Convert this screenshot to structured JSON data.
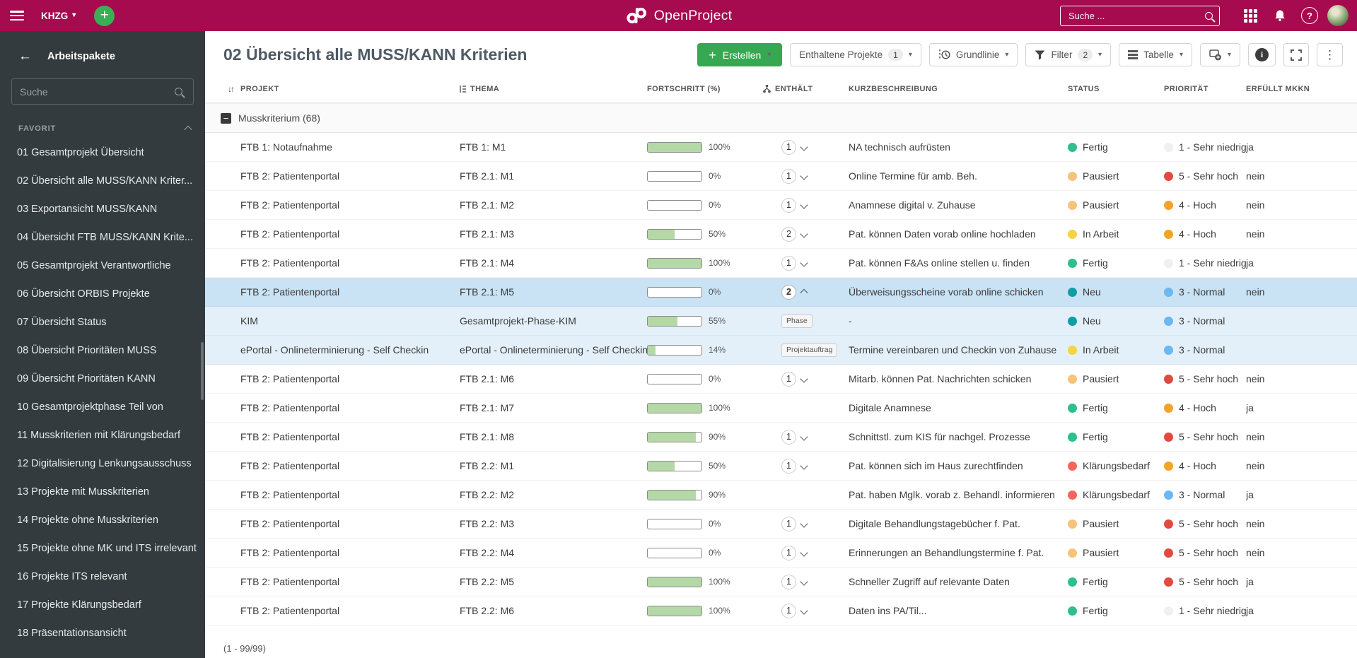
{
  "icons": {
    "caret": "▾",
    "kebab": "⋮",
    "back": "←",
    "plus": "+",
    "question": "?",
    "sort": "↓↑",
    "collapse": "−",
    "info": "i"
  },
  "header": {
    "project_selector": "KHZG",
    "logo_text": "OpenProject",
    "search_placeholder": "Suche ..."
  },
  "sidebar": {
    "title": "Arbeitspakete",
    "search_placeholder": "Suche",
    "section": "FAVORIT",
    "items": [
      "01 Gesamtprojekt Übersicht",
      "02 Übersicht alle MUSS/KANN Kriter...",
      "03 Exportansicht MUSS/KANN",
      "04 Übersicht FTB MUSS/KANN Krite...",
      "05 Gesamtprojekt Verantwortliche",
      "06 Übersicht ORBIS Projekte",
      "07 Übersicht Status",
      "08 Übersicht Prioritäten MUSS",
      "09 Übersicht Prioritäten KANN",
      "10 Gesamtprojektphase Teil von",
      "11 Musskriterien mit Klärungsbedarf",
      "12 Digitalisierung Lenkungsausschuss",
      "13 Projekte mit Musskriterien",
      "14 Projekte ohne Musskriterien",
      "15 Projekte ohne MK und ITS irrelevant",
      "16 Projekte ITS relevant",
      "17 Projekte Klärungsbedarf",
      "18 Präsentationsansicht"
    ]
  },
  "toolbar": {
    "title": "02 Übersicht alle MUSS/KANN Kriterien",
    "create_label": "Erstellen",
    "included_projects_label": "Enthaltene Projekte",
    "included_projects_count": "1",
    "baseline_label": "Grundlinie",
    "filter_label": "Filter",
    "filter_count": "2",
    "table_label": "Tabelle"
  },
  "table": {
    "columns": [
      "PROJEKT",
      "THEMA",
      "FORTSCHRITT (%)",
      "ENTHÄLT",
      "KURZBESCHREIBUNG",
      "STATUS",
      "PRIORITÄT",
      "ERFÜLLT MKKN"
    ],
    "group_label": "Musskriterium",
    "group_count": "(68)",
    "status_colors": {
      "Fertig": "#2fbe8f",
      "Pausiert": "#f6c37a",
      "In Arbeit": "#f5d342",
      "Neu": "#0f9ea6",
      "Klärungsbedarf": "#f2665e"
    },
    "priority_colors": {
      "1 - Sehr niedrig": "#f0f0f0",
      "3 - Normal": "#6cb8f0",
      "4 - Hoch": "#f5a22d",
      "5 - Sehr hoch": "#e04a41"
    },
    "rows": [
      {
        "project": "FTB 1: Notaufnahme",
        "thema": "FTB 1: M1",
        "progress": 100,
        "progress_label": "100%",
        "contains": "1",
        "expanded": false,
        "badge": "",
        "desc": "NA technisch aufrüsten",
        "status": "Fertig",
        "priority": "1 - Sehr niedrig",
        "erfuellt": "ja",
        "highlight": ""
      },
      {
        "project": "FTB 2: Patientenportal",
        "thema": "FTB 2.1: M1",
        "progress": 0,
        "progress_label": "0%",
        "contains": "1",
        "expanded": false,
        "badge": "",
        "desc": "Online Termine für amb. Beh.",
        "status": "Pausiert",
        "priority": "5 - Sehr hoch",
        "erfuellt": "nein",
        "highlight": ""
      },
      {
        "project": "FTB 2: Patientenportal",
        "thema": "FTB 2.1: M2",
        "progress": 0,
        "progress_label": "0%",
        "contains": "1",
        "expanded": false,
        "badge": "",
        "desc": "Anamnese digital v. Zuhause",
        "status": "Pausiert",
        "priority": "4 - Hoch",
        "erfuellt": "nein",
        "highlight": ""
      },
      {
        "project": "FTB 2: Patientenportal",
        "thema": "FTB 2.1: M3",
        "progress": 50,
        "progress_label": "50%",
        "contains": "2",
        "expanded": false,
        "badge": "",
        "desc": "Pat. können Daten vorab online hochladen",
        "status": "In Arbeit",
        "priority": "4 - Hoch",
        "erfuellt": "nein",
        "highlight": ""
      },
      {
        "project": "FTB 2: Patientenportal",
        "thema": "FTB 2.1: M4",
        "progress": 100,
        "progress_label": "100%",
        "contains": "1",
        "expanded": false,
        "badge": "",
        "desc": "Pat. können F&As online stellen u. finden",
        "status": "Fertig",
        "priority": "1 - Sehr niedrig",
        "erfuellt": "ja",
        "highlight": ""
      },
      {
        "project": "FTB 2: Patientenportal",
        "thema": "FTB 2.1: M5",
        "progress": 0,
        "progress_label": "0%",
        "contains": "2",
        "expanded": true,
        "badge": "",
        "desc": "Überweisungsscheine vorab online schicken",
        "status": "Neu",
        "priority": "3 - Normal",
        "erfuellt": "nein",
        "highlight": "selected"
      },
      {
        "project": "KIM",
        "thema": "Gesamtprojekt-Phase-KIM",
        "progress": 55,
        "progress_label": "55%",
        "contains": "",
        "expanded": false,
        "badge": "Phase",
        "desc": "-",
        "status": "Neu",
        "priority": "3 - Normal",
        "erfuellt": "",
        "highlight": "child"
      },
      {
        "project": "ePortal - Onlineterminierung - Self Checkin",
        "thema": "ePortal - Onlineterminierung - Self Checkin",
        "progress": 14,
        "progress_label": "14%",
        "contains": "",
        "expanded": false,
        "badge": "Projektauftrag",
        "desc": "Termine vereinbaren und Checkin von Zuhause",
        "status": "In Arbeit",
        "priority": "3 - Normal",
        "erfuellt": "",
        "highlight": "child"
      },
      {
        "project": "FTB 2: Patientenportal",
        "thema": "FTB 2.1: M6",
        "progress": 0,
        "progress_label": "0%",
        "contains": "1",
        "expanded": false,
        "badge": "",
        "desc": "Mitarb. können Pat. Nachrichten schicken",
        "status": "Pausiert",
        "priority": "5 - Sehr hoch",
        "erfuellt": "nein",
        "highlight": ""
      },
      {
        "project": "FTB 2: Patientenportal",
        "thema": "FTB 2.1: M7",
        "progress": 100,
        "progress_label": "100%",
        "contains": "",
        "expanded": false,
        "badge": "",
        "desc": "Digitale Anamnese",
        "status": "Fertig",
        "priority": "4 - Hoch",
        "erfuellt": "ja",
        "highlight": ""
      },
      {
        "project": "FTB 2: Patientenportal",
        "thema": "FTB 2.1: M8",
        "progress": 90,
        "progress_label": "90%",
        "contains": "1",
        "expanded": false,
        "badge": "",
        "desc": "Schnittstl. zum KIS für nachgel. Prozesse",
        "status": "Fertig",
        "priority": "5 - Sehr hoch",
        "erfuellt": "nein",
        "highlight": ""
      },
      {
        "project": "FTB 2: Patientenportal",
        "thema": "FTB 2.2: M1",
        "progress": 50,
        "progress_label": "50%",
        "contains": "1",
        "expanded": false,
        "badge": "",
        "desc": "Pat. können sich im Haus zurechtfinden",
        "status": "Klärungsbedarf",
        "priority": "4 - Hoch",
        "erfuellt": "nein",
        "highlight": ""
      },
      {
        "project": "FTB 2: Patientenportal",
        "thema": "FTB 2.2: M2",
        "progress": 90,
        "progress_label": "90%",
        "contains": "",
        "expanded": false,
        "badge": "",
        "desc": "Pat. haben Mglk. vorab z. Behandl. informieren",
        "status": "Klärungsbedarf",
        "priority": "3 - Normal",
        "erfuellt": "ja",
        "highlight": ""
      },
      {
        "project": "FTB 2: Patientenportal",
        "thema": "FTB 2.2: M3",
        "progress": 0,
        "progress_label": "0%",
        "contains": "1",
        "expanded": false,
        "badge": "",
        "desc": "Digitale Behandlungstagebücher f. Pat.",
        "status": "Pausiert",
        "priority": "5 - Sehr hoch",
        "erfuellt": "nein",
        "highlight": ""
      },
      {
        "project": "FTB 2: Patientenportal",
        "thema": "FTB 2.2: M4",
        "progress": 0,
        "progress_label": "0%",
        "contains": "1",
        "expanded": false,
        "badge": "",
        "desc": "Erinnerungen an Behandlungstermine f. Pat.",
        "status": "Pausiert",
        "priority": "5 - Sehr hoch",
        "erfuellt": "nein",
        "highlight": ""
      },
      {
        "project": "FTB 2: Patientenportal",
        "thema": "FTB 2.2: M5",
        "progress": 100,
        "progress_label": "100%",
        "contains": "1",
        "expanded": false,
        "badge": "",
        "desc": "Schneller Zugriff auf relevante Daten",
        "status": "Fertig",
        "priority": "5 - Sehr hoch",
        "erfuellt": "ja",
        "highlight": ""
      },
      {
        "project": "FTB 2: Patientenportal",
        "thema": "FTB 2.2: M6",
        "progress": 100,
        "progress_label": "100%",
        "contains": "1",
        "expanded": false,
        "badge": "",
        "desc": "Daten ins PA/Til...",
        "status": "Fertig",
        "priority": "1 - Sehr niedrig",
        "erfuellt": "ja",
        "highlight": ""
      }
    ]
  },
  "footer": {
    "pagination": "(1 - 99/99)"
  }
}
